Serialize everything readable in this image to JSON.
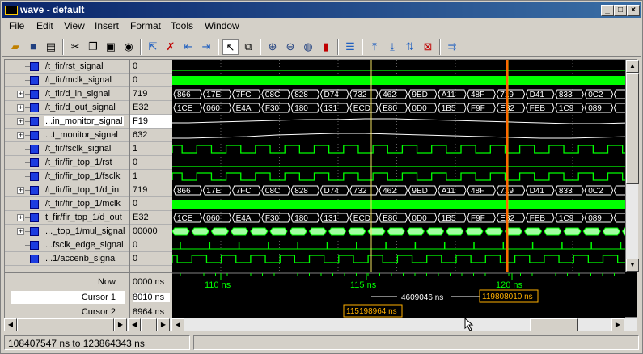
{
  "window": {
    "title": "wave - default"
  },
  "menu": [
    "File",
    "Edit",
    "View",
    "Insert",
    "Format",
    "Tools",
    "Window"
  ],
  "signals": [
    {
      "name": "/t_fir/rst_signal",
      "value": "0",
      "expand": false
    },
    {
      "name": "/t_fir/mclk_signal",
      "value": "0",
      "expand": false
    },
    {
      "name": "/t_fir/d_in_signal",
      "value": "719",
      "expand": true
    },
    {
      "name": "/t_fir/d_out_signal",
      "value": "E32",
      "expand": true
    },
    {
      "name": "...in_monitor_signal",
      "value": "F19",
      "expand": true,
      "selected": true
    },
    {
      "name": "...t_monitor_signal",
      "value": "632",
      "expand": true
    },
    {
      "name": "/t_fir/fsclk_signal",
      "value": "1",
      "expand": false
    },
    {
      "name": "/t_fir/fir_top_1/rst",
      "value": "0",
      "expand": false
    },
    {
      "name": "/t_fir/fir_top_1/fsclk",
      "value": "1",
      "expand": false
    },
    {
      "name": "/t_fir/fir_top_1/d_in",
      "value": "719",
      "expand": true
    },
    {
      "name": "/t_fir/fir_top_1/mclk",
      "value": "0",
      "expand": false
    },
    {
      "name": "t_fir/fir_top_1/d_out",
      "value": "E32",
      "expand": true
    },
    {
      "name": "..._top_1/mul_signal",
      "value": "00000",
      "expand": true
    },
    {
      "name": "...fsclk_edge_signal",
      "value": "0",
      "expand": false
    },
    {
      "name": "...1/accenb_signal",
      "value": "0",
      "expand": false
    }
  ],
  "bus_din": [
    "866",
    "17E",
    "7FC",
    "08C",
    "828",
    "D74",
    "732",
    "462",
    "9ED",
    "A11",
    "48F",
    "719",
    "D41",
    "833",
    "0C2",
    ""
  ],
  "bus_dout": [
    "1CE",
    "060",
    "E4A",
    "F30",
    "180",
    "131",
    "ECD",
    "E80",
    "0D0",
    "1B5",
    "F9F",
    "E32",
    "FEB",
    "1C9",
    "089",
    ""
  ],
  "cursors": {
    "now_label": "Now",
    "now_value": "0000 ns",
    "c1_label": "Cursor 1",
    "c1_value": "8010 ns",
    "c2_label": "Cursor 2",
    "c2_value": "8964 ns"
  },
  "timeline": {
    "ticks": [
      "110 ns",
      "115 ns",
      "120 ns"
    ],
    "delta": "4609046 ns",
    "c1_flag": "119808010 ns",
    "c2_flag": "115198964 ns"
  },
  "status": {
    "range": "108407547 ns to 123864343 ns"
  },
  "colors": {
    "wave": "#00ff00",
    "cursor1": "#ffb000",
    "cursor2": "#f0e060",
    "bg": "#000000"
  }
}
